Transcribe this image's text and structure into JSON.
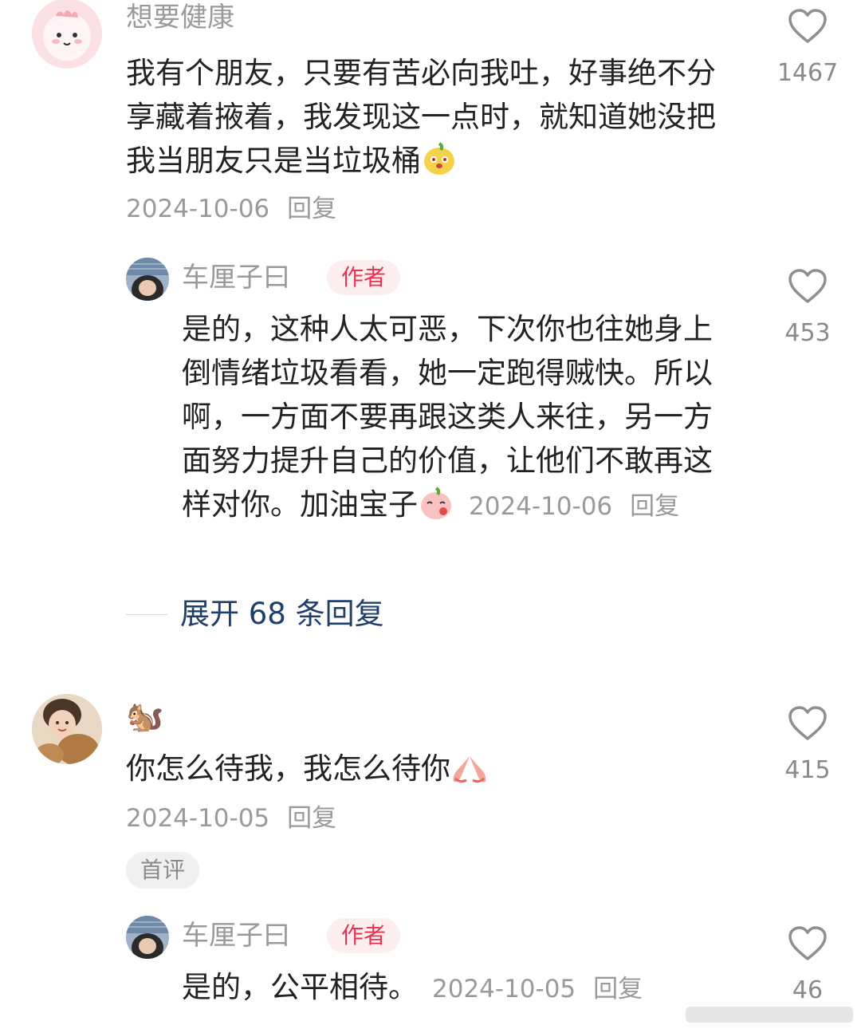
{
  "comments": [
    {
      "user": "想要健康",
      "text": "我有个朋友，只要有苦必向我吐，好事绝不分享藏着掖着，我发现这一点时，就知道她没把我当朋友只是当垃圾桶",
      "date": "2024-10-06",
      "reply_label": "回复",
      "likes": "1467",
      "reply": {
        "user": "车厘子曰",
        "badge": "作者",
        "text": "是的，这种人太可恶，下次你也往她身上倒情绪垃圾看看，她一定跑得贼快。所以啊，一方面不要再跟这类人来往，另一方面努力提升自己的价值，让他们不敢再这样对你。加油宝子",
        "date": "2024-10-06",
        "reply_label": "回复",
        "likes": "453"
      },
      "expand_label": "展开 68 条回复"
    },
    {
      "user_emoji": "🐿️",
      "text": "你怎么待我，我怎么待你",
      "date": "2024-10-05",
      "reply_label": "回复",
      "likes": "415",
      "tag": "首评",
      "reply": {
        "user": "车厘子曰",
        "badge": "作者",
        "text": "是的，公平相待。",
        "date": "2024-10-05",
        "reply_label": "回复",
        "likes": "46"
      }
    }
  ],
  "icons": {
    "like": "heart-outline-icon",
    "emoji_1": "grinning-peach-emoji",
    "emoji_2": "blushing-peach-emoji",
    "emoji_3": "praying-hands-emoji"
  },
  "colors": {
    "author_badge_bg": "#fdeef0",
    "author_badge_text": "#e8334f",
    "expand_link": "#1d3f6a"
  }
}
